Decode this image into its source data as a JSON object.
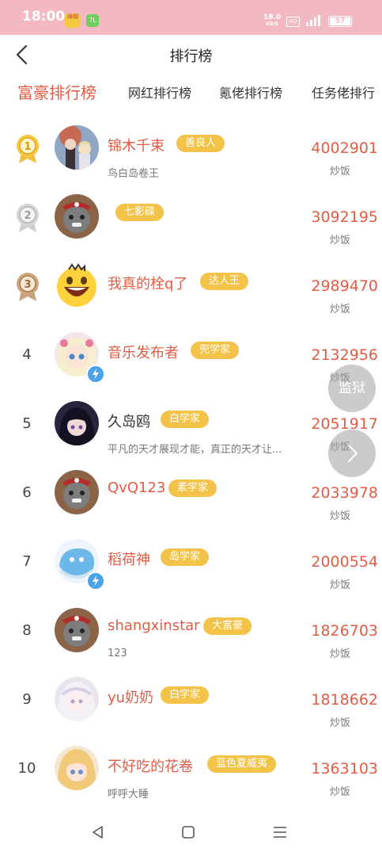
{
  "status_bar": {
    "time": "18:00",
    "app_icon_1": "綠帽",
    "app_icon_2": "7L",
    "net_speed": "18.0",
    "net_unit": "KB/S",
    "hd": "HD",
    "battery": "57"
  },
  "header": {
    "title": "排行榜"
  },
  "tabs": [
    "富豪排行榜",
    "网红排行榜",
    "氪佬排行榜",
    "任务佬排行"
  ],
  "rows": [
    {
      "rank": "1",
      "name": "锦木千束",
      "tag": "善良人",
      "sub": "鸟白岛卷王",
      "amount": "4002901",
      "unit": "炒饭"
    },
    {
      "rank": "2",
      "name": "",
      "tag": "七影碟",
      "sub": "",
      "amount": "3092195",
      "unit": "炒饭"
    },
    {
      "rank": "3",
      "name": "我真的栓q了",
      "tag": "达人王",
      "sub": "",
      "amount": "2989470",
      "unit": "炒饭"
    },
    {
      "rank": "4",
      "name": "音乐发布者",
      "tag": "兜学家",
      "sub": "",
      "amount": "2132956",
      "unit": "炒饭"
    },
    {
      "rank": "5",
      "name": "久岛鸥",
      "tag": "白学家",
      "sub": "平凡的天才展现才能，真正的天才让...",
      "amount": "2051917",
      "unit": "炒饭"
    },
    {
      "rank": "6",
      "name": "QvQ123",
      "tag": "素学家",
      "sub": "",
      "amount": "2033978",
      "unit": "炒饭"
    },
    {
      "rank": "7",
      "name": "稻荷神",
      "tag": "岛学家",
      "sub": "",
      "amount": "2000554",
      "unit": "炒饭"
    },
    {
      "rank": "8",
      "name": "shangxinstar",
      "tag": "大富豪",
      "sub": "123",
      "amount": "1826703",
      "unit": "炒饭"
    },
    {
      "rank": "9",
      "name": "yu奶奶",
      "tag": "白学家",
      "sub": "",
      "amount": "1818662",
      "unit": "炒饭"
    },
    {
      "rank": "10",
      "name": "不好吃的花卷",
      "tag": "蓝色夏威夷",
      "sub": "呼呼大睡",
      "amount": "1363103",
      "unit": "炒饭"
    }
  ],
  "float_buttons": {
    "jail": "监狱",
    "next_icon": "chevron-right-icon"
  },
  "colors": {
    "accent": "#e25c45",
    "tag": "#f2c348",
    "status_bar": "#f3b9c3"
  }
}
